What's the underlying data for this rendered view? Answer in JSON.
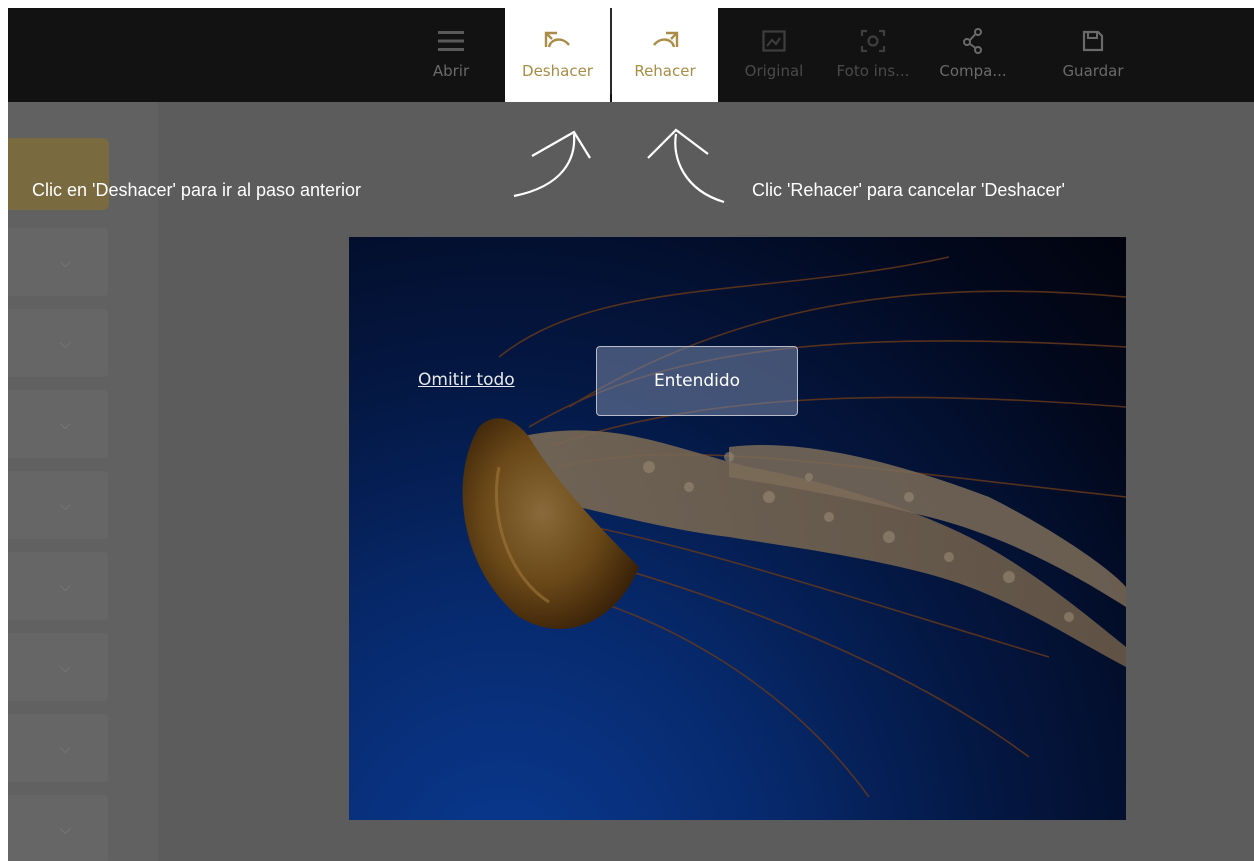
{
  "toolbar": {
    "items": [
      {
        "label": "Abrir",
        "icon": "menu-icon"
      },
      {
        "label": "Deshacer",
        "icon": "undo-icon"
      },
      {
        "label": "Rehacer",
        "icon": "redo-icon"
      },
      {
        "label": "Original",
        "icon": "image-icon"
      },
      {
        "label": "Foto ins...",
        "icon": "focus-icon"
      },
      {
        "label": "Compa...",
        "icon": "share-icon"
      },
      {
        "label": "Guardar",
        "icon": "save-icon"
      }
    ]
  },
  "tutorial": {
    "undo_hint": "Clic en 'Deshacer' para ir al paso anterior",
    "redo_hint": "Clic 'Rehacer' para cancelar 'Deshacer'",
    "skip_label": "Omitir todo",
    "ok_label": "Entendido"
  },
  "colors": {
    "accent": "#a98c45",
    "toolbar_bg": "#121212",
    "overlay_bg": "#5e5e5e"
  }
}
